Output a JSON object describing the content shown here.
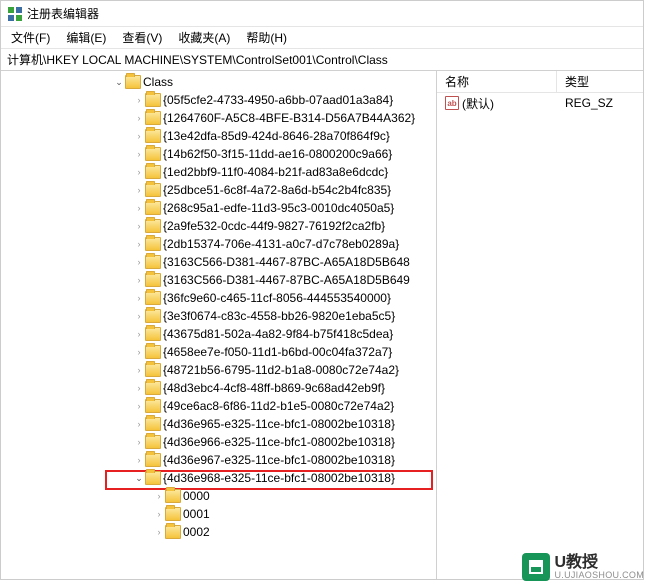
{
  "window": {
    "title": "注册表编辑器"
  },
  "menu": {
    "file": "文件(F)",
    "edit": "编辑(E)",
    "view": "查看(V)",
    "favorites": "收藏夹(A)",
    "help": "帮助(H)"
  },
  "address": "计算机\\HKEY LOCAL MACHINE\\SYSTEM\\ControlSet001\\Control\\Class",
  "tree": {
    "root_label": "Class",
    "items": [
      "{05f5cfe2-4733-4950-a6bb-07aad01a3a84}",
      "{1264760F-A5C8-4BFE-B314-D56A7B44A362}",
      "{13e42dfa-85d9-424d-8646-28a70f864f9c}",
      "{14b62f50-3f15-11dd-ae16-0800200c9a66}",
      "{1ed2bbf9-11f0-4084-b21f-ad83a8e6dcdc}",
      "{25dbce51-6c8f-4a72-8a6d-b54c2b4fc835}",
      "{268c95a1-edfe-11d3-95c3-0010dc4050a5}",
      "{2a9fe532-0cdc-44f9-9827-76192f2ca2fb}",
      "{2db15374-706e-4131-a0c7-d7c78eb0289a}",
      "{3163C566-D381-4467-87BC-A65A18D5B648",
      "{3163C566-D381-4467-87BC-A65A18D5B649",
      "{36fc9e60-c465-11cf-8056-444553540000}",
      "{3e3f0674-c83c-4558-bb26-9820e1eba5c5}",
      "{43675d81-502a-4a82-9f84-b75f418c5dea}",
      "{4658ee7e-f050-11d1-b6bd-00c04fa372a7}",
      "{48721b56-6795-11d2-b1a8-0080c72e74a2}",
      "{48d3ebc4-4cf8-48ff-b869-9c68ad42eb9f}",
      "{49ce6ac8-6f86-11d2-b1e5-0080c72e74a2}",
      "{4d36e965-e325-11ce-bfc1-08002be10318}",
      "{4d36e966-e325-11ce-bfc1-08002be10318}",
      "{4d36e967-e325-11ce-bfc1-08002be10318}"
    ],
    "expanded_label": "{4d36e968-e325-11ce-bfc1-08002be10318}",
    "children": [
      "0000",
      "0001",
      "0002"
    ]
  },
  "details": {
    "col_name": "名称",
    "col_type": "类型",
    "row_icon_text": "ab",
    "row_name": "(默认)",
    "row_type": "REG_SZ"
  },
  "watermark": {
    "brand": "U教授",
    "url": "U.UJIAOSHOU.COM"
  }
}
